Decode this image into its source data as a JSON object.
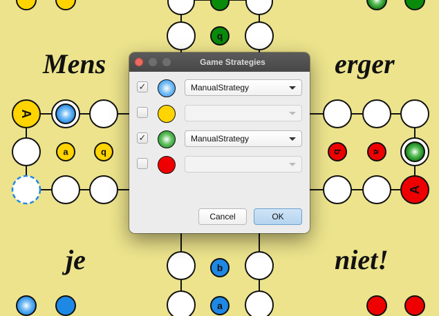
{
  "board": {
    "words": [
      "Mens",
      "erger",
      "je",
      "niet!"
    ],
    "colors": {
      "background": "#ece38c",
      "yellow": "#ffd400",
      "green": "#0a8a0a",
      "red": "#ee0000",
      "blue": "#1e88e5"
    },
    "field_letters": {
      "yellow_top": "q",
      "blue_bottom_1": "b",
      "blue_bottom_2": "a",
      "yellow_home_1": "a",
      "yellow_home_2": "q",
      "yellow_start": "A",
      "red_home_1": "b",
      "red_home_2": "a",
      "red_start": "A"
    }
  },
  "dialog": {
    "title": "Game Strategies",
    "rows": [
      {
        "checked": true,
        "check_mark": "✓",
        "player_color": "blue",
        "strategy": "ManualStrategy",
        "enabled": true
      },
      {
        "checked": false,
        "check_mark": "",
        "player_color": "yellow",
        "strategy": "",
        "enabled": false
      },
      {
        "checked": true,
        "check_mark": "✓",
        "player_color": "green",
        "strategy": "ManualStrategy",
        "enabled": true
      },
      {
        "checked": false,
        "check_mark": "",
        "player_color": "red",
        "strategy": "",
        "enabled": false
      }
    ],
    "cancel_label": "Cancel",
    "ok_label": "OK"
  }
}
